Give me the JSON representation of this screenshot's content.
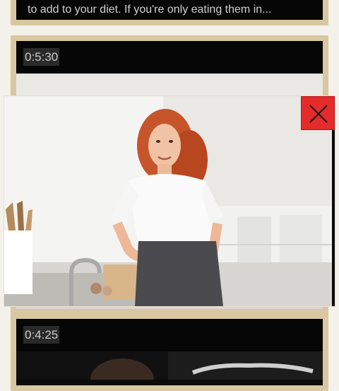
{
  "cards": [
    {
      "teaser": "to add to your diet. If you're only eating them in..."
    },
    {
      "duration": "0:5:30"
    },
    {
      "duration": "0:4:25"
    }
  ],
  "popup": {
    "close_icon": "close-icon"
  },
  "colors": {
    "card_frame": "#d8c7a1",
    "close_button": "#e52b2b",
    "background": "#f4f1ea"
  }
}
